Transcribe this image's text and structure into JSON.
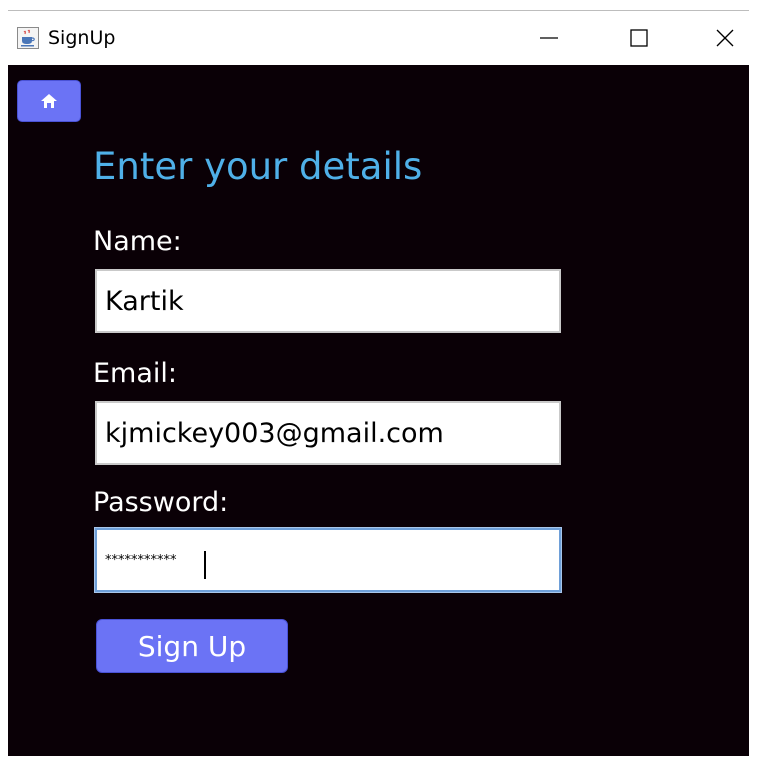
{
  "window": {
    "title": "SignUp",
    "app_icon": "java-cup-icon",
    "controls": [
      "minimize-icon",
      "maximize-icon",
      "close-icon"
    ]
  },
  "home_button": {
    "icon": "home-icon"
  },
  "form": {
    "heading": "Enter your details",
    "name_label": "Name:",
    "name_value": "Kartik",
    "email_label": "Email:",
    "email_value": "kjmickey003@gmail.com",
    "password_label": "Password:",
    "password_value": "***********",
    "submit_label": "Sign Up"
  },
  "colors": {
    "background": "#0a0006",
    "heading": "#4fb0e8",
    "button": "#6b73f5",
    "label": "#ffffff"
  }
}
